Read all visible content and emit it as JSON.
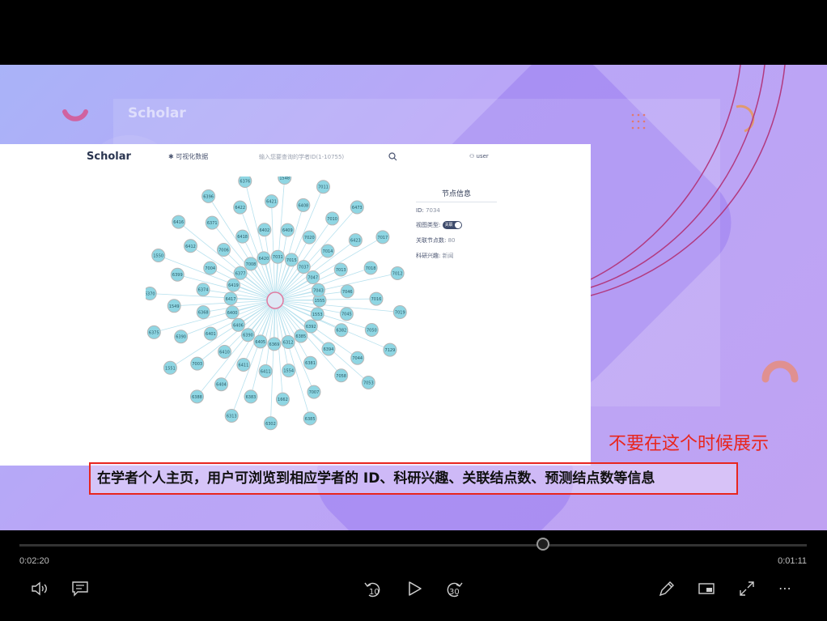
{
  "app": {
    "logo": "Scholar",
    "nav_item": "可视化数据",
    "search_placeholder": "输入您要查询的学者ID(1-10755)",
    "user_label": "user"
  },
  "node_panel": {
    "title": "节点信息",
    "id_label": "ID:",
    "id_value": "7034",
    "view_type_label": "视图类型:",
    "view_type_toggle": "关联",
    "related_count_label": "关联节点数:",
    "related_count_value": "80",
    "interest_label": "科研兴趣:",
    "interest_value": "新闻"
  },
  "graph": {
    "center_node": "7034",
    "nodes": [
      "1555",
      "6382",
      "7058",
      "6385",
      "1553",
      "6394",
      "7007",
      "6302",
      "6392",
      "6381",
      "1662",
      "6313",
      "6385",
      "1554",
      "6383",
      "6388",
      "6312",
      "6411",
      "6404",
      "1551",
      "6369",
      "6411",
      "7003",
      "6375",
      "6405",
      "6410",
      "6390",
      "6370",
      "6390",
      "6401",
      "1549",
      "1550",
      "6406",
      "6368",
      "6399",
      "6416",
      "6400",
      "6374",
      "6412",
      "6396",
      "6417",
      "7004",
      "6371",
      "6376",
      "6419",
      "7006",
      "6422",
      "1548",
      "6377",
      "6418",
      "6421",
      "7011",
      "7008",
      "6402",
      "6408",
      "6473",
      "6420",
      "6409",
      "7010",
      "7017",
      "7031",
      "7020",
      "6423",
      "7012",
      "7015",
      "7014",
      "7018",
      "7019",
      "7037",
      "7013",
      "7016",
      "7129",
      "7047",
      "7046",
      "7050",
      "7053",
      "7043",
      "7045",
      "7044"
    ]
  },
  "caption": "在学者个人主页，用户可浏览到相应学者的 ID、科研兴趣、关联结点数、预测结点数等信息",
  "annotation": "不要在这个时候展示",
  "player": {
    "elapsed": "0:02:20",
    "remaining": "0:01:11",
    "progress": 0.665,
    "skip_back_label": "10",
    "skip_forward_label": "30"
  }
}
